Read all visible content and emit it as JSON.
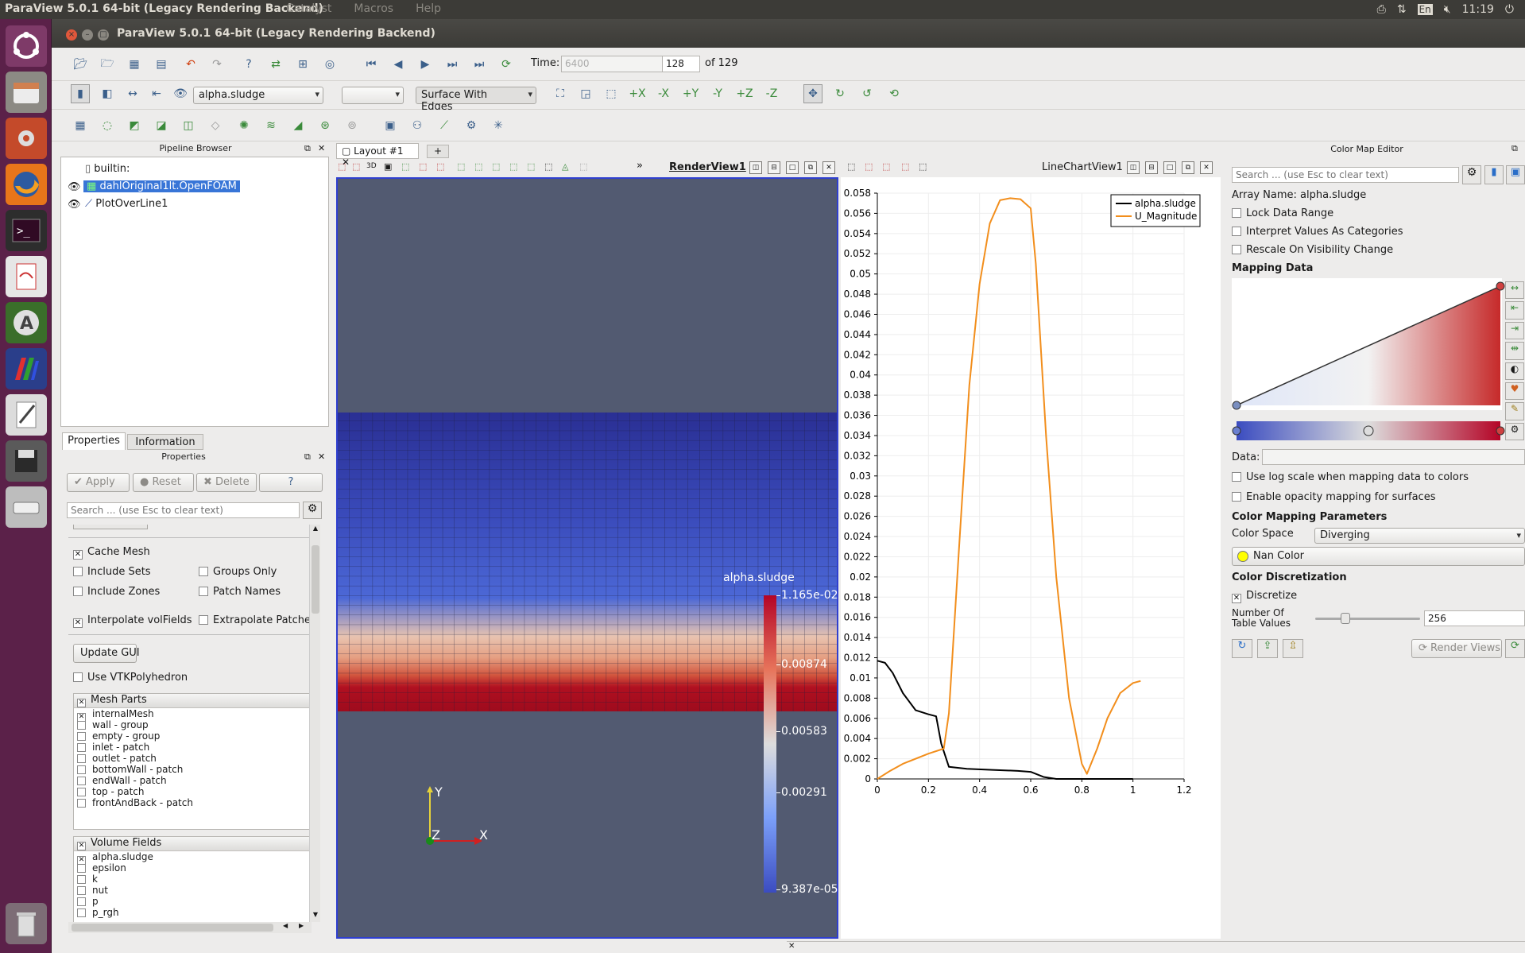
{
  "os": {
    "title": "ParaView 5.0.1 64-bit (Legacy Rendering Backend)",
    "menus": [
      "Catalyst",
      "Macros",
      "Help"
    ],
    "lang": "En",
    "time": "11:19"
  },
  "window": {
    "title": "ParaView 5.0.1 64-bit (Legacy Rendering Backend)"
  },
  "toolbar": {
    "time_label": "Time:",
    "time_value": "6400",
    "step": "128",
    "of": "of 129",
    "array": "alpha.sludge",
    "component": "",
    "representation": "Surface With Edges"
  },
  "pipeline": {
    "header": "Pipeline Browser",
    "items": [
      "builtin:",
      "dahlOriginal1lt.OpenFOAM",
      "PlotOverLine1"
    ]
  },
  "props": {
    "tab1": "Properties",
    "tab2": "Information",
    "header": "Properties",
    "apply": "Apply",
    "reset": "Reset",
    "delete": "Delete",
    "help": "?",
    "search_placeholder": "Search ... (use Esc to clear text)",
    "cache_mesh": "Cache Mesh",
    "include_sets": "Include Sets",
    "groups_only": "Groups Only",
    "include_zones": "Include Zones",
    "patch_names": "Patch Names",
    "interpolate": "Interpolate volFields",
    "extrapolate": "Extrapolate Patches",
    "update_gui": "Update GUI",
    "use_vtk": "Use VTKPolyhedron",
    "mesh_parts_title": "Mesh Parts",
    "mesh_parts": [
      "internalMesh",
      "wall - group",
      "empty - group",
      "inlet - patch",
      "outlet - patch",
      "bottomWall - patch",
      "endWall - patch",
      "top - patch",
      "frontAndBack - patch"
    ],
    "volume_fields_title": "Volume Fields",
    "volume_fields": [
      "alpha.sludge",
      "epsilon",
      "k",
      "nut",
      "p",
      "p_rgh"
    ]
  },
  "layout": {
    "tab": "Layout #1",
    "add": "+",
    "render_view": "RenderView1",
    "chart_view": "LineChartView1",
    "more": "»",
    "threed": "3D"
  },
  "colorbar": {
    "title": "alpha.sludge",
    "ticks": [
      "1.165e-02",
      "0.00874",
      "0.00583",
      "0.00291",
      "9.387e-05"
    ]
  },
  "axes": {
    "y": "Y",
    "z": "Z",
    "x": "X"
  },
  "chart_data": {
    "type": "line",
    "xlim": [
      0,
      1.2
    ],
    "ylim": [
      0,
      0.058
    ],
    "x_ticks": [
      "0",
      "0.2",
      "0.4",
      "0.6",
      "0.8",
      "1",
      "1.2"
    ],
    "y_ticks": [
      "0",
      "0.002",
      "0.004",
      "0.006",
      "0.008",
      "0.01",
      "0.012",
      "0.014",
      "0.016",
      "0.018",
      "0.02",
      "0.022",
      "0.024",
      "0.026",
      "0.028",
      "0.03",
      "0.032",
      "0.034",
      "0.036",
      "0.038",
      "0.04",
      "0.042",
      "0.044",
      "0.046",
      "0.048",
      "0.05",
      "0.052",
      "0.054",
      "0.056",
      "0.058"
    ],
    "legend_position": "top-right",
    "series": [
      {
        "name": "alpha.sludge",
        "color": "#000000",
        "x": [
          0,
          0.03,
          0.06,
          0.1,
          0.15,
          0.2,
          0.23,
          0.25,
          0.28,
          0.35,
          0.45,
          0.55,
          0.6,
          0.65,
          0.7,
          0.8,
          1.0
        ],
        "y": [
          0.0117,
          0.0115,
          0.0105,
          0.0085,
          0.0068,
          0.0064,
          0.0062,
          0.0035,
          0.0012,
          0.001,
          0.0009,
          0.0008,
          0.0007,
          0.0002,
          0.0,
          0.0,
          0.0
        ]
      },
      {
        "name": "U_Magnitude",
        "color": "#f28e1c",
        "x": [
          0,
          0.05,
          0.1,
          0.2,
          0.26,
          0.28,
          0.32,
          0.36,
          0.4,
          0.44,
          0.48,
          0.52,
          0.56,
          0.6,
          0.62,
          0.66,
          0.7,
          0.75,
          0.8,
          0.82,
          0.86,
          0.9,
          0.95,
          1.0,
          1.03
        ],
        "y": [
          0.0,
          0.0008,
          0.0015,
          0.0025,
          0.003,
          0.0065,
          0.023,
          0.039,
          0.049,
          0.055,
          0.0573,
          0.0575,
          0.0574,
          0.0565,
          0.051,
          0.034,
          0.02,
          0.008,
          0.0015,
          0.0005,
          0.003,
          0.006,
          0.0085,
          0.0095,
          0.0097
        ]
      }
    ]
  },
  "cme": {
    "header": "Color Map Editor",
    "search_placeholder": "Search ... (use Esc to clear text)",
    "array_name": "Array Name: alpha.sludge",
    "lock": "Lock Data Range",
    "interpret": "Interpret Values As Categories",
    "rescale": "Rescale On Visibility Change",
    "mapping": "Mapping Data",
    "data_label": "Data:",
    "log": "Use log scale when mapping data to colors",
    "opacity": "Enable opacity mapping for surfaces",
    "cmp": "Color Mapping Parameters",
    "color_space_label": "Color Space",
    "color_space": "Diverging",
    "nan": "Nan Color",
    "disc_title": "Color Discretization",
    "discretize": "Discretize",
    "ntv1": "Number Of",
    "ntv2": "Table Values",
    "ntv_value": "256",
    "render_views": "Render Views"
  }
}
